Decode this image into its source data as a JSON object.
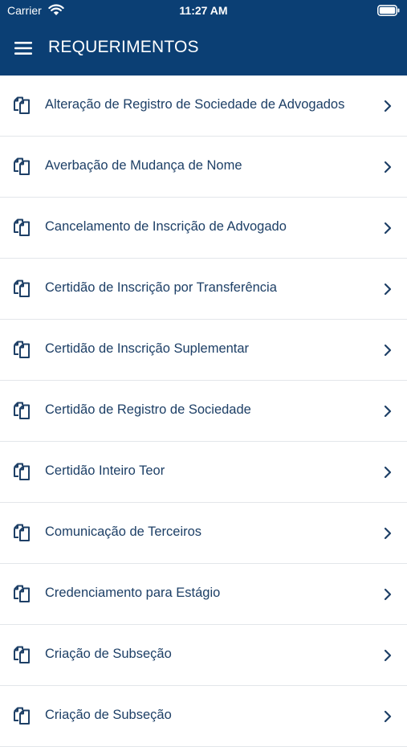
{
  "status_bar": {
    "carrier": "Carrier",
    "time": "11:27 AM"
  },
  "header": {
    "title": "REQUERIMENTOS"
  },
  "colors": {
    "header_bg": "#0b3f74",
    "text": "#1d3f66",
    "divider": "#e3e6ea"
  },
  "icons": {
    "menu": "hamburger-menu-icon",
    "item": "copy-document-icon",
    "chevron": "chevron-right-icon"
  },
  "items": [
    {
      "label": "Alteração de Registro de Sociedade de Advogados"
    },
    {
      "label": "Averbação de Mudança de Nome"
    },
    {
      "label": "Cancelamento de Inscrição de Advogado"
    },
    {
      "label": "Certidão de Inscrição por Transferência"
    },
    {
      "label": "Certidão de Inscrição Suplementar"
    },
    {
      "label": "Certidão de Registro de Sociedade"
    },
    {
      "label": "Certidão Inteiro Teor"
    },
    {
      "label": "Comunicação de Terceiros"
    },
    {
      "label": "Credenciamento para Estágio"
    },
    {
      "label": "Criação de Subseção"
    },
    {
      "label": "Criação de Subseção"
    }
  ]
}
